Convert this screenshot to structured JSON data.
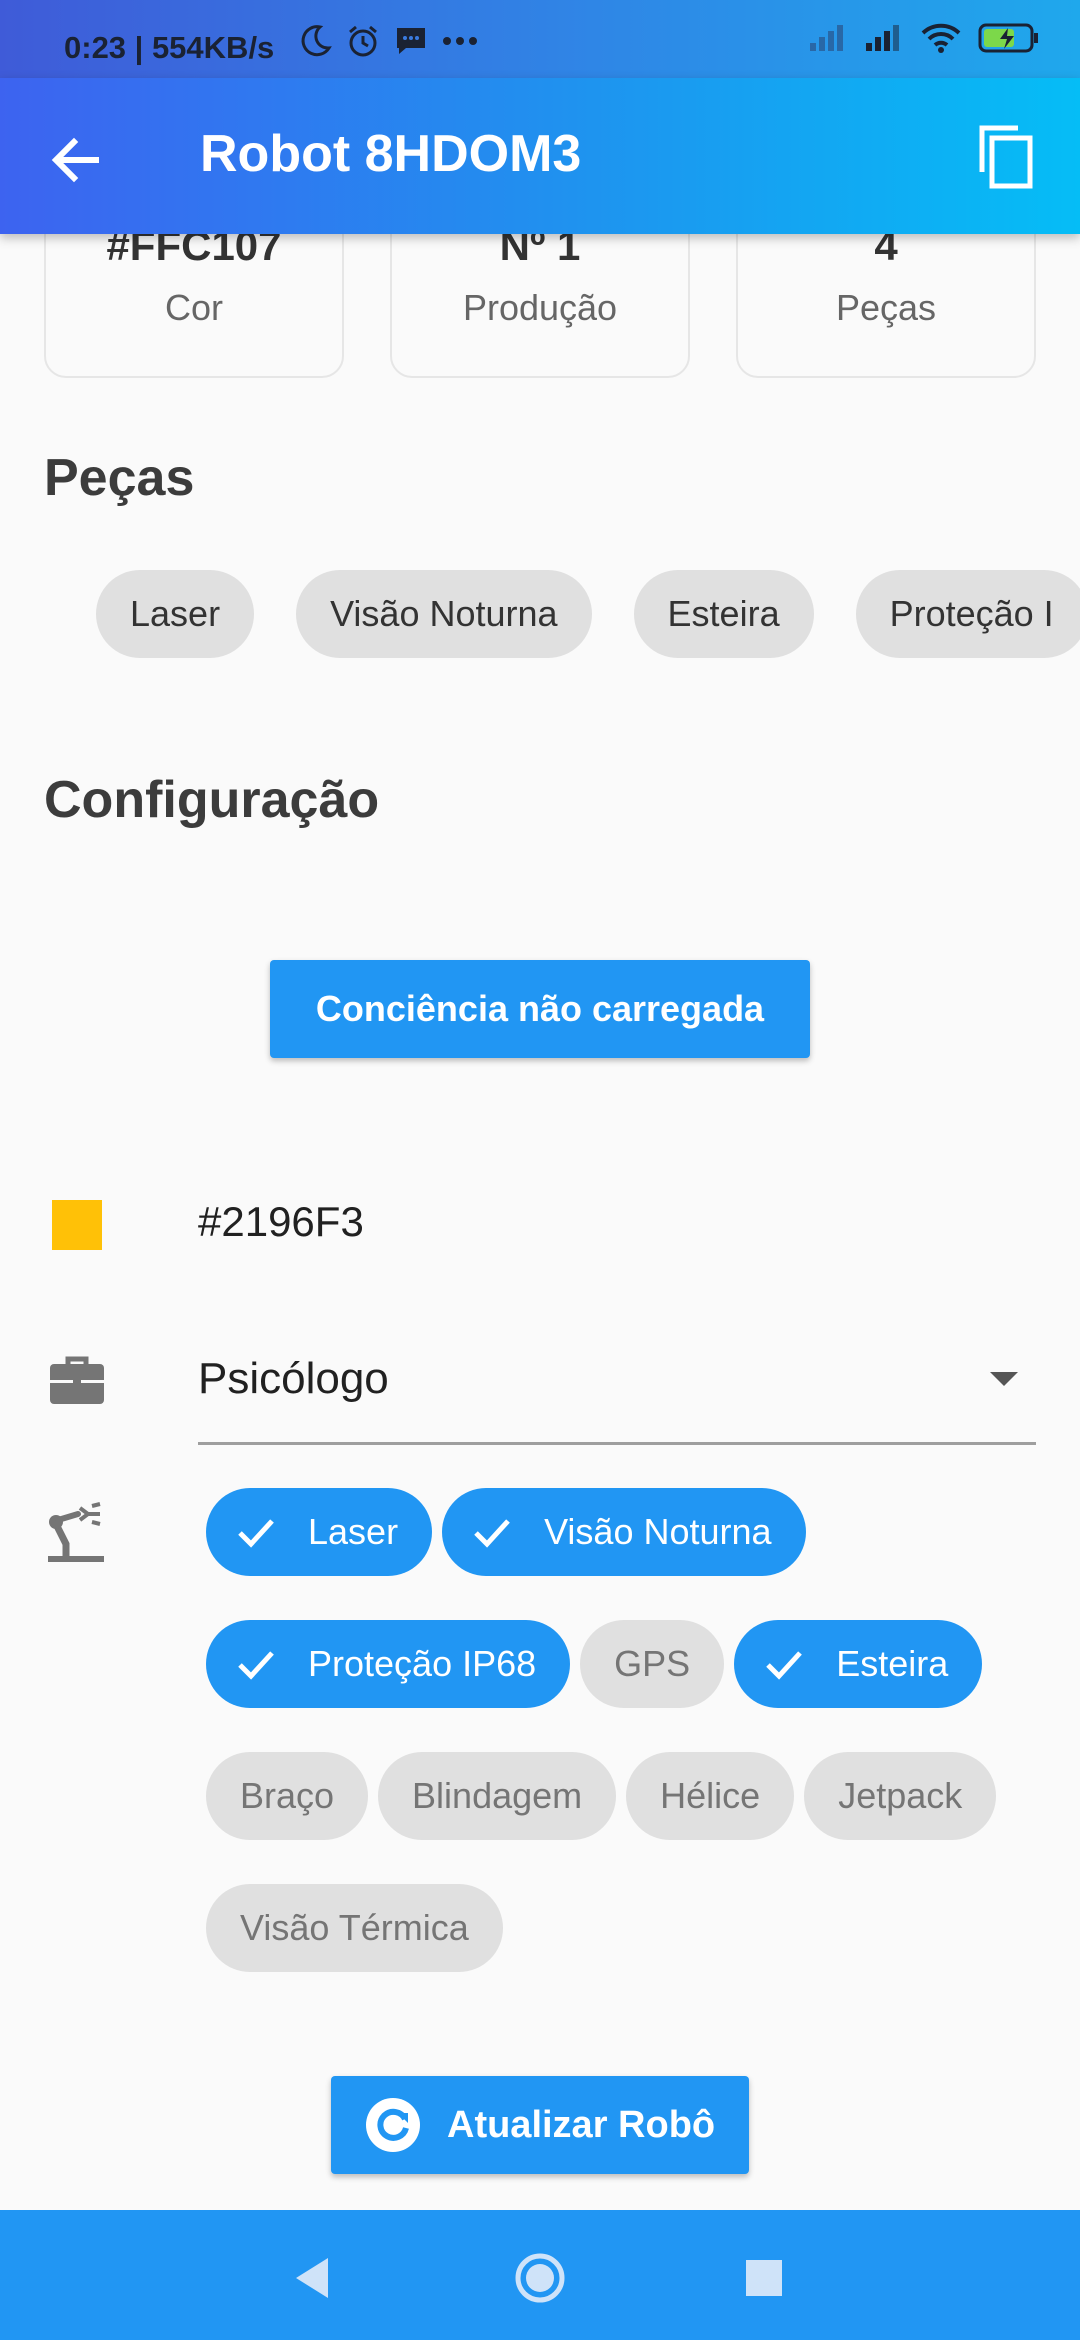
{
  "status_bar": {
    "time": "0:23 | 554KB/s",
    "icons": [
      "moon-icon",
      "alarm-icon",
      "message-icon",
      "more-icon",
      "signal-icon",
      "signal-icon",
      "wifi-icon",
      "battery-charging-icon"
    ]
  },
  "app_bar": {
    "title": "Robot 8HDOM3",
    "back_icon": "arrow-back-icon",
    "copy_icon": "copy-icon"
  },
  "stats": [
    {
      "value": "#FFC107",
      "label": "Cor"
    },
    {
      "value": "Nº 1",
      "label": "Produção"
    },
    {
      "value": "4",
      "label": "Peças"
    }
  ],
  "parts_section": {
    "title": "Peças",
    "chips": [
      "Laser",
      "Visão Noturna",
      "Esteira",
      "Proteção I"
    ]
  },
  "config_section": {
    "title": "Configuração",
    "conscience_button": "Conciência não carregada",
    "color_code": "#2196F3",
    "swatch_color": "#FFC107",
    "profession": "Psicólogo",
    "parts_rows": [
      [
        {
          "label": "Laser",
          "selected": true
        },
        {
          "label": "Visão Noturna",
          "selected": true
        }
      ],
      [
        {
          "label": "Proteção IP68",
          "selected": true
        },
        {
          "label": "GPS",
          "selected": false
        },
        {
          "label": "Esteira",
          "selected": true
        }
      ],
      [
        {
          "label": "Braço",
          "selected": false
        },
        {
          "label": "Blindagem",
          "selected": false
        },
        {
          "label": "Hélice",
          "selected": false
        },
        {
          "label": "Jetpack",
          "selected": false
        }
      ],
      [
        {
          "label": "Visão Térmica",
          "selected": false
        }
      ]
    ]
  },
  "update_button": {
    "label": "Atualizar Robô",
    "icon": "refresh-icon"
  },
  "nav_bar": {
    "icons": [
      "nav-back-icon",
      "nav-home-icon",
      "nav-recents-icon"
    ]
  },
  "colors": {
    "primary": "#2196F3",
    "chip_grey": "#E0E0E0"
  }
}
